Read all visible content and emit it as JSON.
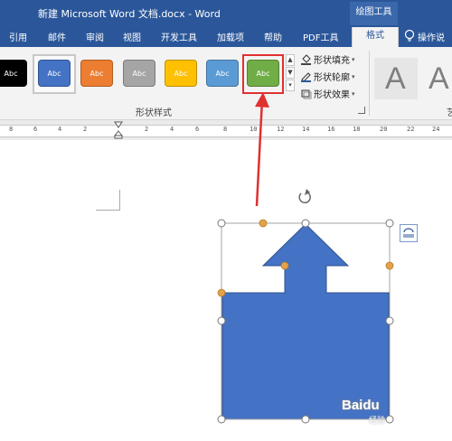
{
  "window": {
    "title": "新建 Microsoft Word 文档.docx  -  Word",
    "context_tab_label": "绘图工具"
  },
  "tabs": [
    {
      "label": "引用"
    },
    {
      "label": "邮件"
    },
    {
      "label": "审阅"
    },
    {
      "label": "视图"
    },
    {
      "label": "开发工具"
    },
    {
      "label": "加载项"
    },
    {
      "label": "帮助"
    },
    {
      "label": "PDF工具"
    },
    {
      "label": "格式"
    },
    {
      "label": "操作说"
    }
  ],
  "ribbon": {
    "shape_styles": [
      {
        "label": "Abc",
        "fill": "#000000"
      },
      {
        "label": "Abc",
        "fill": "#4472c4"
      },
      {
        "label": "Abc",
        "fill": "#ed7d31"
      },
      {
        "label": "Abc",
        "fill": "#a5a5a5"
      },
      {
        "label": "Abc",
        "fill": "#ffc000"
      },
      {
        "label": "Abc",
        "fill": "#5b9bd5"
      },
      {
        "label": "Abc",
        "fill": "#70ad47"
      }
    ],
    "selected_style_index": 1,
    "highlighted_style_index": 6,
    "shape_styles_group_label": "形状样式",
    "shape_fill_label": "形状填充",
    "shape_outline_label": "形状轮廓",
    "shape_effects_label": "形状效果",
    "wordart_letter": "A",
    "truncated_group_label": "艺"
  },
  "ruler": {
    "ticks": [
      "8",
      "6",
      "4",
      "2",
      "2",
      "4",
      "6",
      "8",
      "10",
      "12",
      "14",
      "16",
      "18",
      "20",
      "22",
      "24"
    ]
  },
  "document": {
    "shape": "arrow",
    "shape_fill": "#4472c4",
    "shape_outline": "#2f528f"
  },
  "colors": {
    "accent": "#2b579a",
    "highlight": "#e03030"
  },
  "watermark": {
    "brand": "Baidu",
    "sub": "经验"
  }
}
